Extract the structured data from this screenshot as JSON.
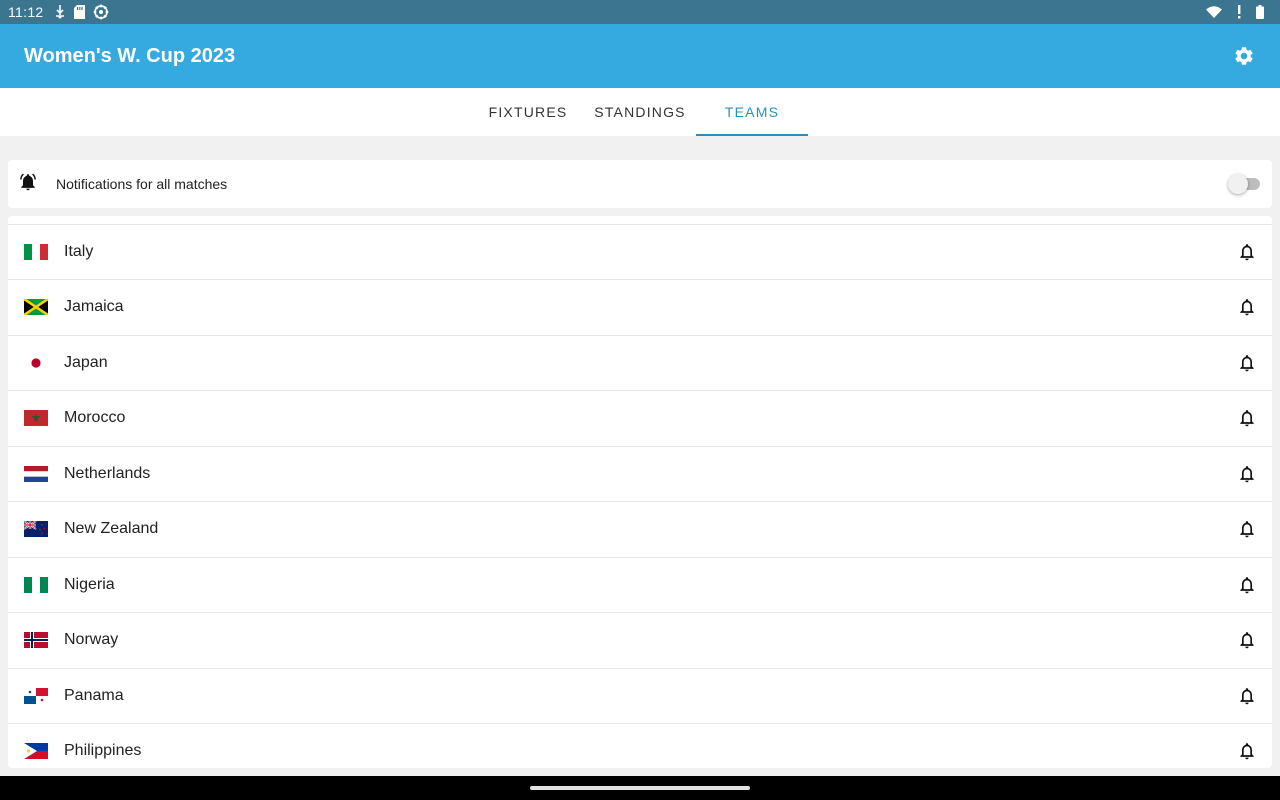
{
  "status_bar": {
    "time": "11:12"
  },
  "app_bar": {
    "title": "Women's W. Cup 2023"
  },
  "tabs": [
    {
      "label": "FIXTURES"
    },
    {
      "label": "STANDINGS"
    },
    {
      "label": "TEAMS",
      "selected": true
    }
  ],
  "notifications": {
    "label": "Notifications for all matches",
    "enabled": false
  },
  "teams": [
    {
      "name": "Italy",
      "flag": "italy-flag-icon"
    },
    {
      "name": "Jamaica",
      "flag": "jamaica-flag-icon"
    },
    {
      "name": "Japan",
      "flag": "japan-flag-icon"
    },
    {
      "name": "Morocco",
      "flag": "morocco-flag-icon"
    },
    {
      "name": "Netherlands",
      "flag": "netherlands-flag-icon"
    },
    {
      "name": "New Zealand",
      "flag": "new-zealand-flag-icon"
    },
    {
      "name": "Nigeria",
      "flag": "nigeria-flag-icon"
    },
    {
      "name": "Norway",
      "flag": "norway-flag-icon"
    },
    {
      "name": "Panama",
      "flag": "panama-flag-icon"
    },
    {
      "name": "Philippines",
      "flag": "philippines-flag-icon"
    }
  ],
  "colors": {
    "status_bar": "#3b7590",
    "app_bar": "#35aae0",
    "accent": "#2a8fc0"
  }
}
